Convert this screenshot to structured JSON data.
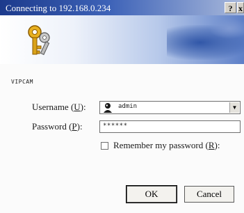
{
  "window": {
    "title": "Connecting to 192.168.0.234",
    "help_label": "?",
    "close_label": "x"
  },
  "icons": {
    "banner": "keys-icon",
    "user": "user-icon",
    "dropdown": "chevron-down-icon"
  },
  "realm": "VIPCAM",
  "form": {
    "username_label_pre": "Username (",
    "username_accel": "U",
    "username_label_post": "):",
    "username_value": "admin",
    "password_label_pre": "Password (",
    "password_accel": "P",
    "password_label_post": "):",
    "password_value": "******",
    "remember_label_pre": "Remember my password (",
    "remember_accel": "R",
    "remember_label_post": "):",
    "remember_checked": false
  },
  "buttons": {
    "ok_label": "OK",
    "cancel_label": "Cancel"
  },
  "colors": {
    "title_bar": "#1c3a8c",
    "banner_accent": "#3157a8"
  }
}
